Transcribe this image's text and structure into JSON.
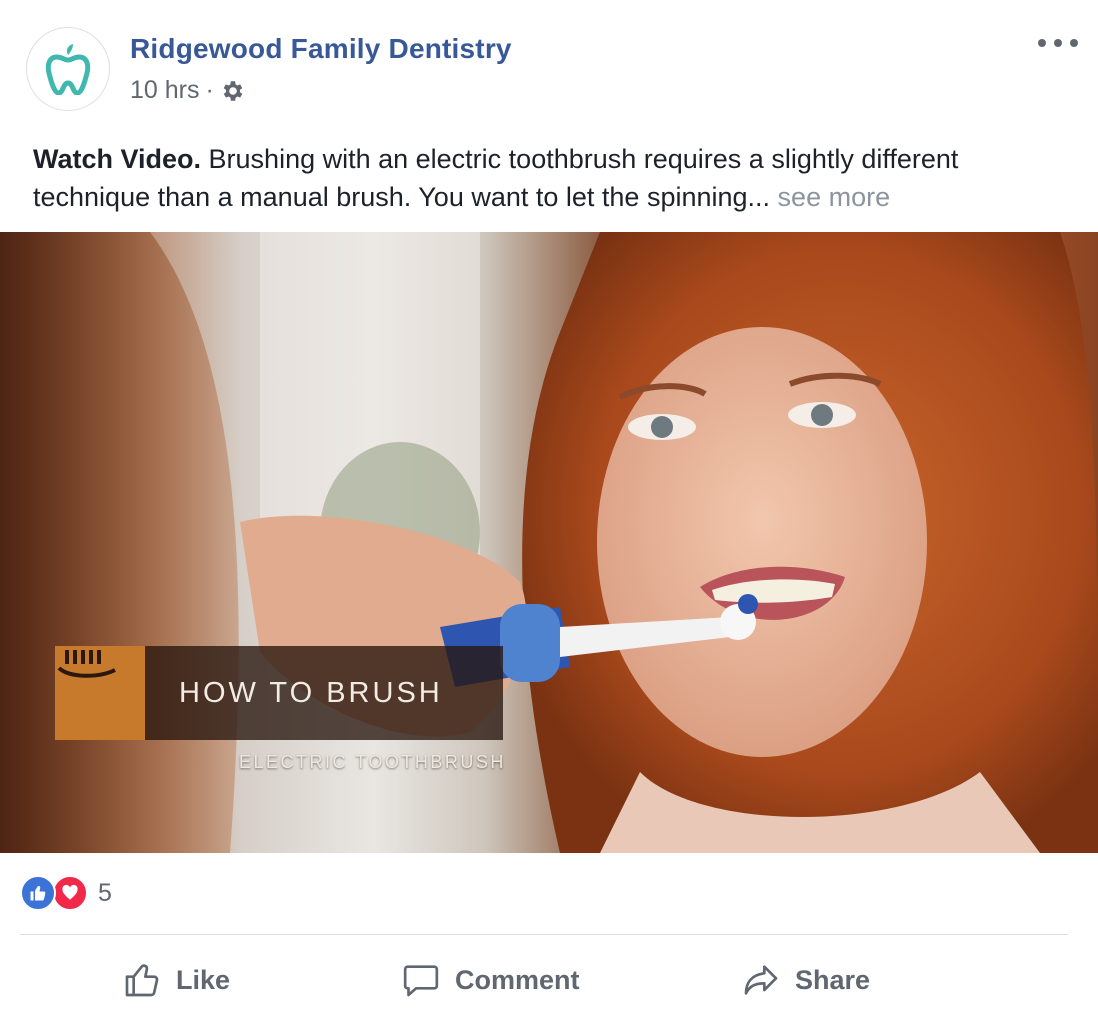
{
  "post": {
    "page_name": "Ridgewood Family Dentistry",
    "time": "10 hrs",
    "separator": "·",
    "privacy_icon": "gear-icon",
    "more_icon": "more-options-icon",
    "text_bold": "Watch Video.",
    "text_body": " Brushing with an electric toothbrush requires a slightly different technique than a manual brush. You want to let the spinning...",
    "see_more": "see more"
  },
  "video": {
    "title": "HOW TO BRUSH",
    "subtitle": "ELECTRIC TOOTHBRUSH",
    "logo_icon": "toothbrush-icon"
  },
  "reactions": {
    "icons": [
      "like-icon",
      "love-icon"
    ],
    "count": "5"
  },
  "actions": {
    "like": "Like",
    "comment": "Comment",
    "share": "Share"
  },
  "colors": {
    "name_blue": "#385898",
    "secondary_text": "#606770",
    "like_blue": "#3b73d6",
    "love_red": "#f0284a",
    "logo_teal": "#3fb8b0",
    "title_orange": "#c87a2c"
  }
}
